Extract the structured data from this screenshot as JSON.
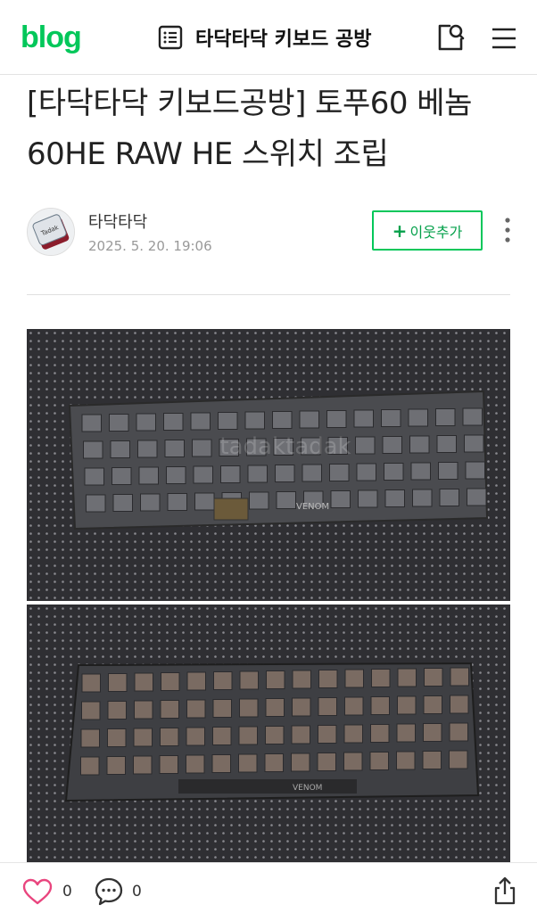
{
  "header": {
    "logo": "blog",
    "blog_title": "타닥타닥 키보드 공방",
    "icons": {
      "list": "list-icon",
      "search": "search-icon",
      "menu": "menu-icon"
    },
    "accent_color": "#03c75a"
  },
  "post": {
    "title": "[타닥타닥 키보드공방] 토푸60 베놈60HE RAW HE 스위치 조립",
    "author": "타닥타닥",
    "date": "2025. 5. 20. 19:06",
    "follow_label": "이웃추가",
    "follow_plus": "+",
    "avatar_key_text": "Tadak"
  },
  "images": [
    {
      "watermark": "tadaktadak",
      "pcb_label": "VENOM"
    },
    {
      "pcb_label": "VENOM"
    }
  ],
  "footer": {
    "like_count": "0",
    "comment_count": "0",
    "icons": {
      "like": "heart-icon",
      "comment": "comment-icon",
      "share": "share-icon"
    }
  }
}
